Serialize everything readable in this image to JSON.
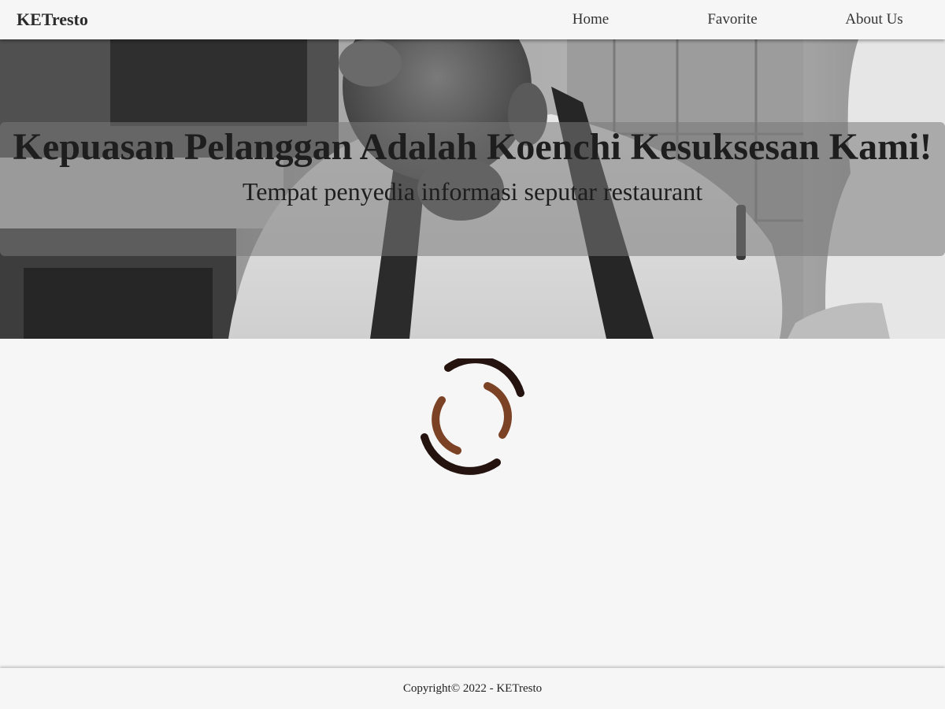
{
  "header": {
    "brand": "KETresto",
    "nav": [
      {
        "label": "Home"
      },
      {
        "label": "Favorite"
      },
      {
        "label": "About Us"
      }
    ]
  },
  "hero": {
    "title": "Kepuasan Pelanggan Adalah Koenchi Kesuksesan Kami!",
    "tagline": "Tempat penyedia informasi seputar restaurant"
  },
  "loader": {
    "icon": "loading-spinner-icon",
    "colors": {
      "outer": "#24130e",
      "inner": "#7b4225"
    }
  },
  "footer": {
    "copyright": "Copyright© 2022 - KETresto"
  }
}
